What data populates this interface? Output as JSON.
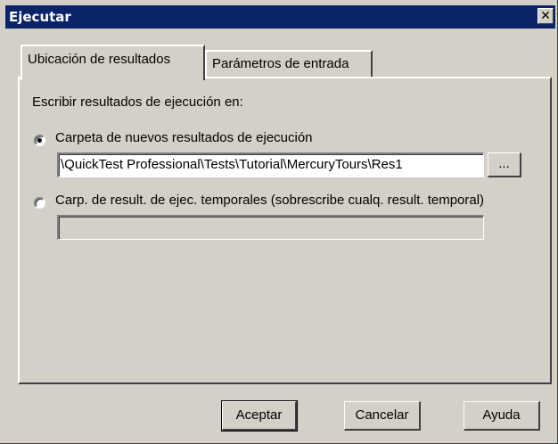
{
  "window": {
    "title": "Ejecutar",
    "close_glyph": "✕"
  },
  "tabs": [
    {
      "label": "Ubicación de resultados",
      "active": true
    },
    {
      "label": "Parámetros de entrada",
      "active": false
    }
  ],
  "panel": {
    "heading": "Escribir resultados de ejecución en:",
    "option_new": {
      "label": "Carpeta de nuevos resultados de ejecución",
      "checked": true,
      "path_value": "\\QuickTest Professional\\Tests\\Tutorial\\MercuryTours\\Res1",
      "browse_label": "..."
    },
    "option_temp": {
      "label": "Carp. de result. de ejec. temporales (sobrescribe cualq. result. temporal)",
      "checked": false,
      "path_value": ""
    }
  },
  "buttons": {
    "ok": "Aceptar",
    "cancel": "Cancelar",
    "help": "Ayuda"
  },
  "colors": {
    "titlebar": "#0a246a",
    "face": "#d4d0c8"
  }
}
